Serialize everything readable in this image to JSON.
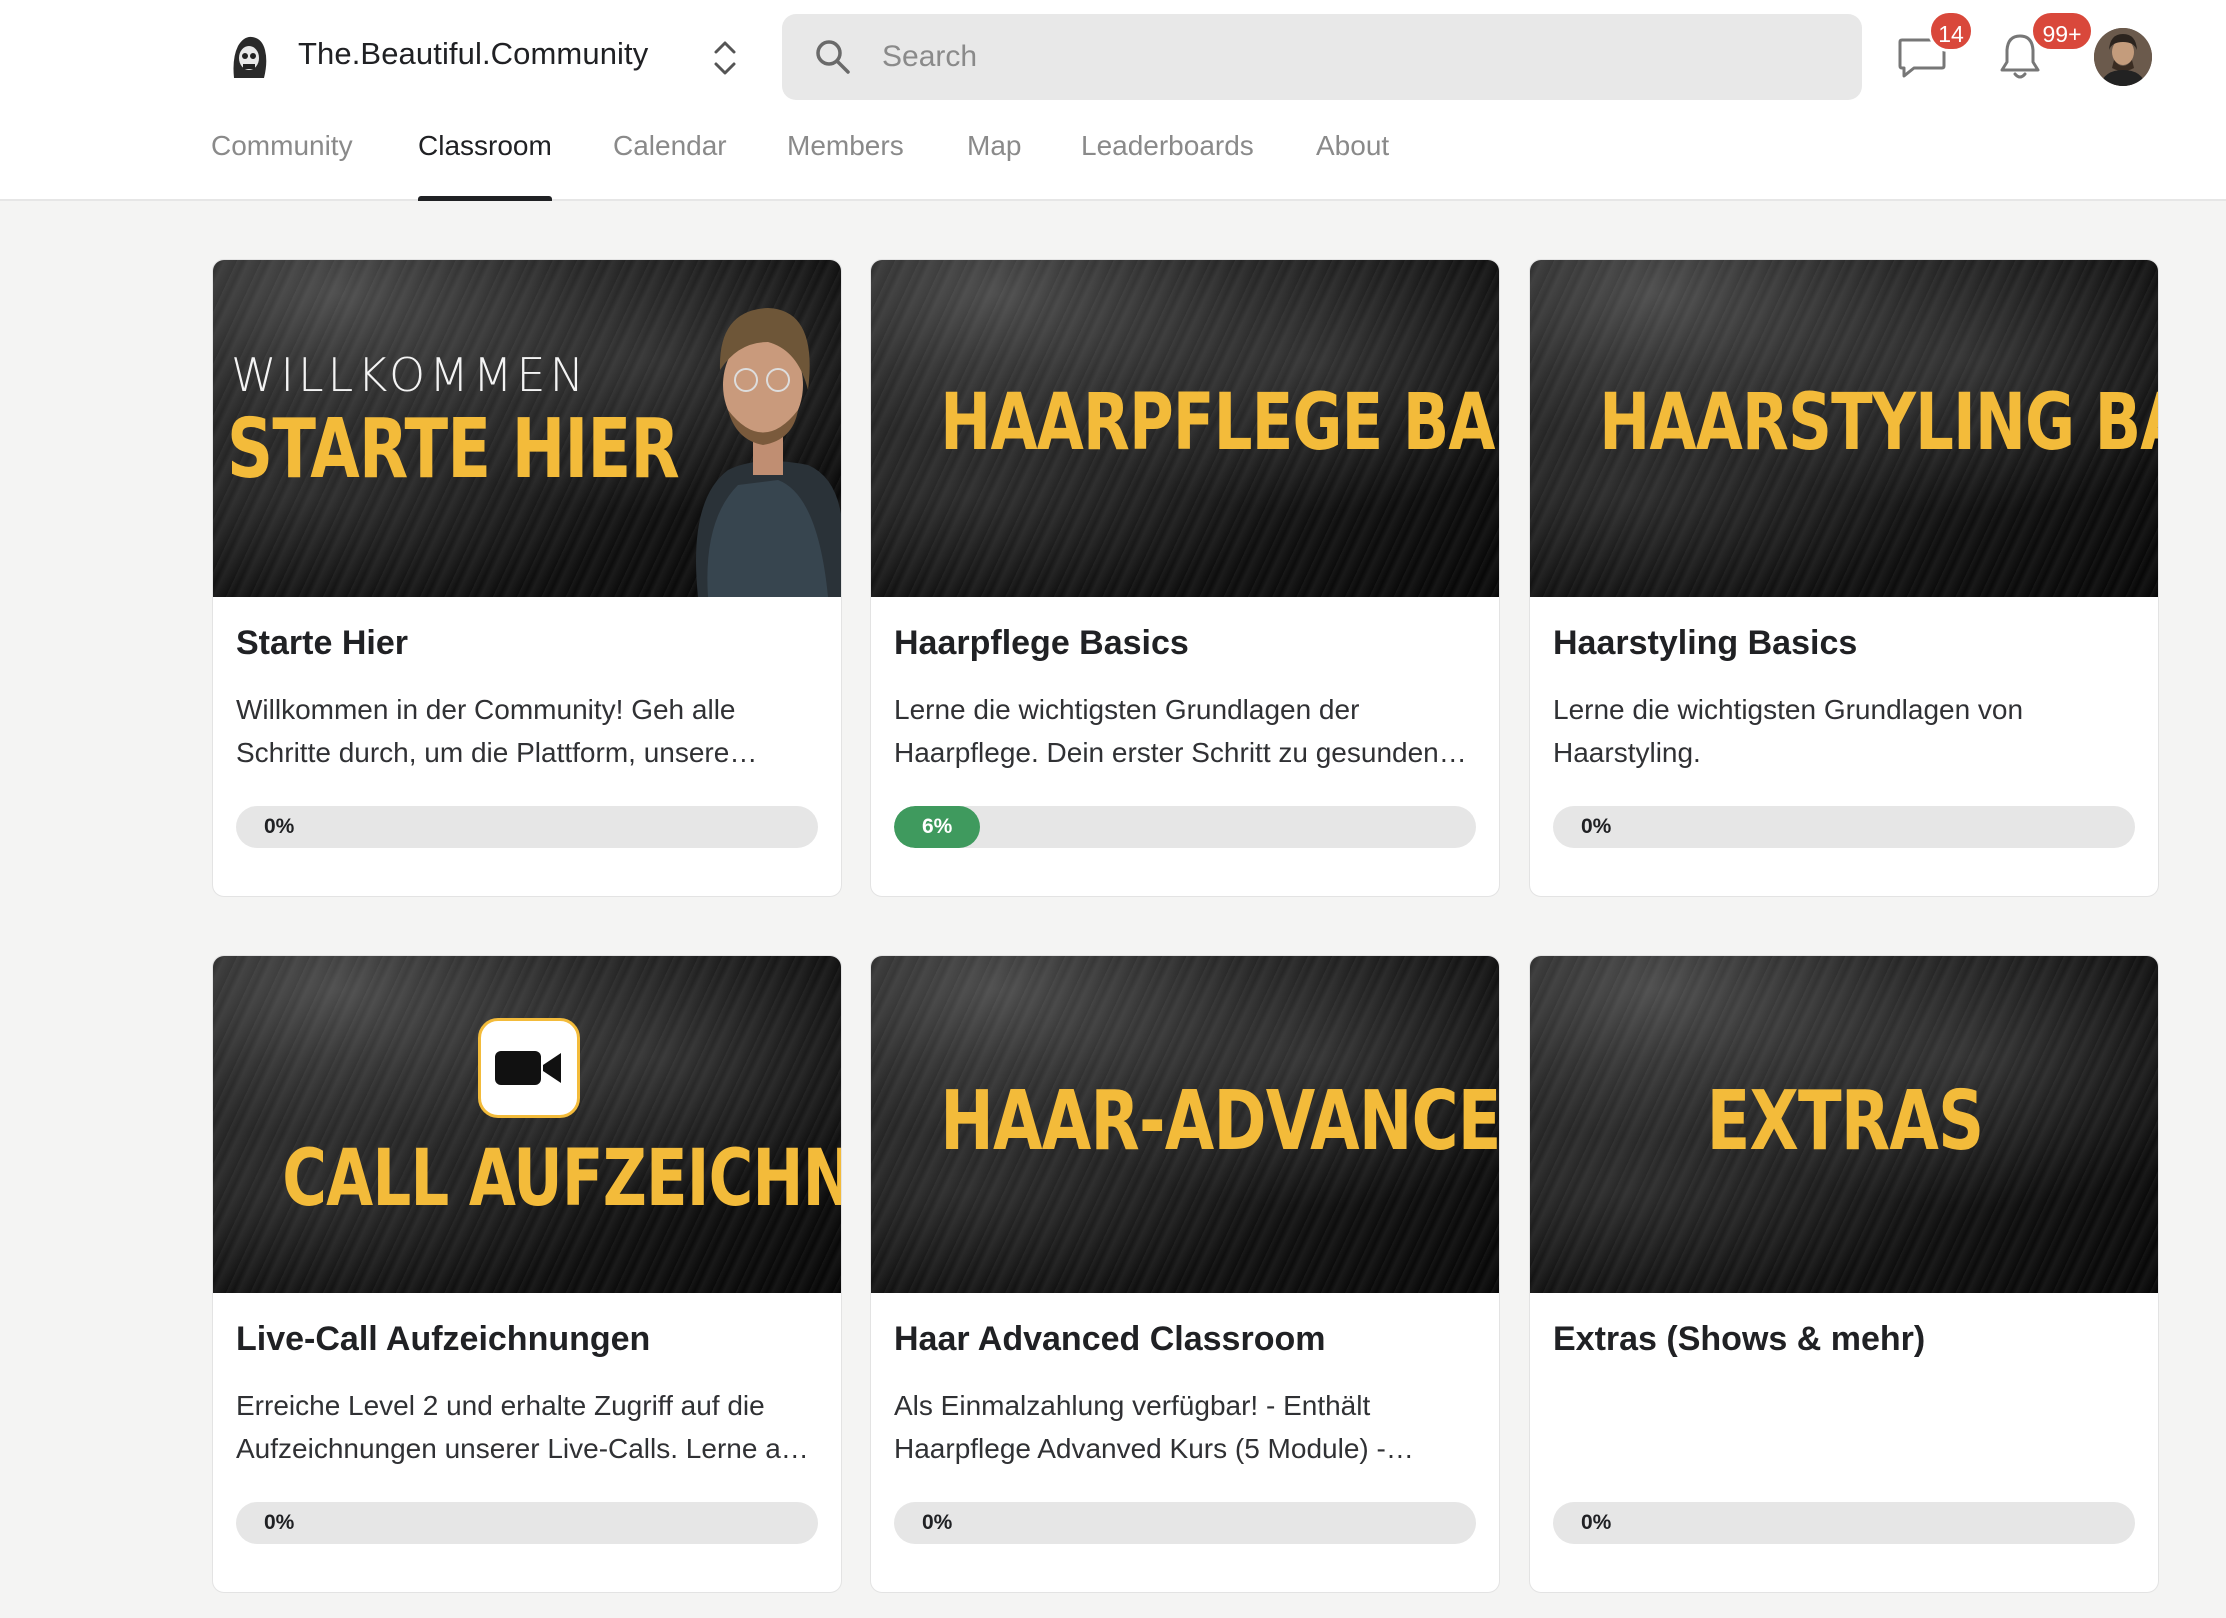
{
  "header": {
    "community_name": "The.Beautiful.Community",
    "search_placeholder": "Search",
    "chat_badge": "14",
    "notifications_badge": "99+"
  },
  "tabs": [
    {
      "label": "Community",
      "active": false
    },
    {
      "label": "Classroom",
      "active": true
    },
    {
      "label": "Calendar",
      "active": false
    },
    {
      "label": "Members",
      "active": false
    },
    {
      "label": "Map",
      "active": false
    },
    {
      "label": "Leaderboards",
      "active": false
    },
    {
      "label": "About",
      "active": false
    }
  ],
  "colors": {
    "accent_yellow": "#f3bb3a",
    "progress_green": "#3f9a5e",
    "badge_red": "#d9483b"
  },
  "courses": [
    {
      "cover_subtitle": "WILLKOMMEN",
      "cover_title": "STARTE HIER",
      "title": "Starte Hier",
      "description": "Willkommen in der Community! Geh alle Schritte durch, um die Plattform, unsere…",
      "progress": 0,
      "progress_label": "0%"
    },
    {
      "cover_title": "HAARPFLEGE BASICS",
      "title": "Haarpflege Basics",
      "description": "Lerne die wichtigsten Grundlagen der Haarpflege. Dein erster Schritt zu gesunden…",
      "progress": 6,
      "progress_label": "6%"
    },
    {
      "cover_title": "HAARSTYLING BASICS",
      "title": "Haarstyling Basics",
      "description": "Lerne die wichtigsten Grundlagen von Haarstyling.",
      "progress": 0,
      "progress_label": "0%"
    },
    {
      "cover_title": "CALL AUFZEICHNUNGEN",
      "title": "Live-Call Aufzeichnungen",
      "description": "Erreiche Level 2 und erhalte Zugriff auf die Aufzeichnungen unserer Live-Calls. Lerne a…",
      "progress": 0,
      "progress_label": "0%"
    },
    {
      "cover_title": "HAAR-ADVANCED",
      "title": "Haar Advanced Classroom",
      "description": "Als Einmalzahlung verfügbar! - Enthält Haarpflege Advanved Kurs (5 Module) -…",
      "progress": 0,
      "progress_label": "0%"
    },
    {
      "cover_title": "EXTRAS",
      "title": "Extras (Shows & mehr)",
      "description": "",
      "progress": 0,
      "progress_label": "0%"
    }
  ]
}
